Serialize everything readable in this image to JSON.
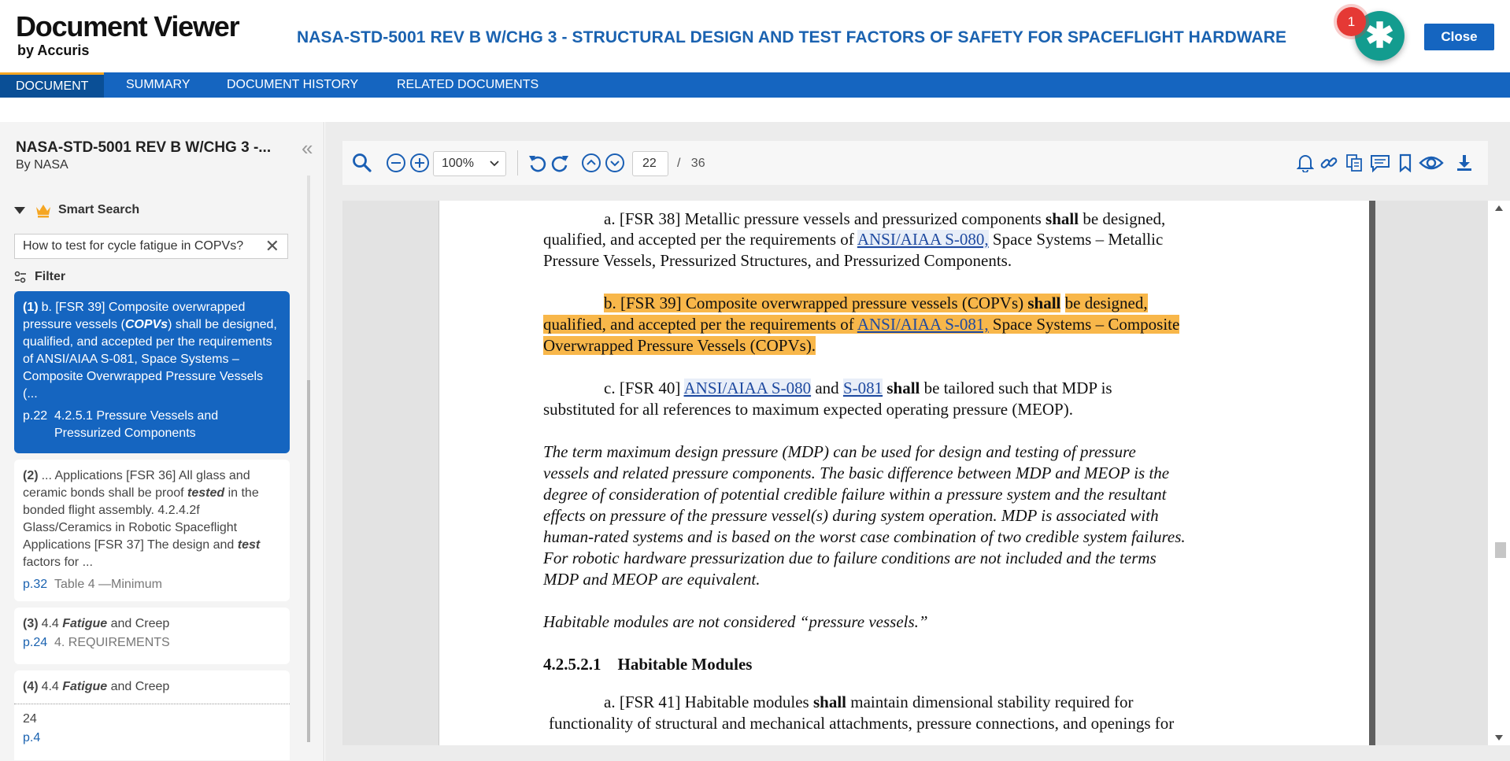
{
  "app": {
    "title": "Document Viewer",
    "subtitle": "by Accuris",
    "document_title": "NASA-STD-5001 REV B W/CHG 3 - STRUCTURAL DESIGN AND TEST FACTORS OF SAFETY FOR SPACEFLIGHT HARDWARE",
    "notification_count": "1",
    "assistant_icon": "✱",
    "close_label": "Close"
  },
  "colors": {
    "brand": "#1565c0",
    "accent": "#139c8f",
    "highlight": "#f8b74a",
    "badge": "#e53935"
  },
  "tabs": [
    {
      "label": "DOCUMENT",
      "active": true
    },
    {
      "label": "SUMMARY",
      "active": false
    },
    {
      "label": "DOCUMENT HISTORY",
      "active": false
    },
    {
      "label": "RELATED DOCUMENTS",
      "active": false
    }
  ],
  "sidebar": {
    "doc_name": "NASA-STD-5001 REV B W/CHG 3 -...",
    "by": "By NASA",
    "collapse_icon": "«",
    "smart_search_label": "Smart Search",
    "search_value": "How to test for cycle fatigue in COPVs?",
    "clear_icon": "✕",
    "filter_label": "Filter",
    "results": [
      {
        "num": "(1)",
        "text_a": "b. [FSR 39] Composite overwrapped pressure vessels (",
        "text_b": "COPVs",
        "text_c": ") shall be designed, qualified, and accepted per the requirements of ANSI/AIAA S-081, Space Systems – Composite Overwrapped Pressure Vessels (...",
        "page": "p.22",
        "section": "4.2.5.1 Pressure Vessels and Pressurized Components"
      },
      {
        "num": "(2)",
        "text_a": "... Applications [FSR 36] All glass and ceramic bonds shall be proof ",
        "text_b": "tested",
        "text_c": " in the bonded flight assembly. 4.2.4.2f Glass/Ceramics in Robotic Spaceflight Applications [FSR 37] The design and ",
        "text_d": "test",
        "text_e": " factors for ...",
        "page": "p.32",
        "section": "Table 4 —Minimum"
      },
      {
        "num": "(3)",
        "text_a": "4.4 ",
        "text_b": "Fatigue",
        "text_c": " and Creep",
        "page": "p.24",
        "section": "4. REQUIREMENTS"
      },
      {
        "num": "(4)",
        "text_a": "4.4 ",
        "text_b": "Fatigue",
        "text_c": " and Creep",
        "extra": "24",
        "page": "p.4"
      }
    ]
  },
  "toolbar": {
    "zoom": "100%",
    "current_page": "22",
    "page_sep": "/",
    "total_pages": "36"
  },
  "document": {
    "p_a_1": "a.   [FSR 38] Metallic pressure vessels and pressurized components ",
    "p_a_shall": "shall",
    "p_a_2": " be designed,",
    "p_a_3": "qualified, and accepted per the requirements of ",
    "p_a_link": "ANSI/AIAA S-080,",
    "p_a_4": " Space Systems – Metallic",
    "p_a_5": "Pressure Vessels, Pressurized Structures, and Pressurized Components.",
    "p_b_1": "b.   [FSR 39] Composite overwrapped pressure vessels (COPVs) ",
    "p_b_shall": "shall",
    "p_b_2": " be designed,",
    "p_b_3": "qualified, and accepted per the requirements of ",
    "p_b_link": "ANSI/AIAA S-081,",
    "p_b_4": " Space Systems – Composite",
    "p_b_5": "Overwrapped Pressure Vessels (COPVs).",
    "p_c_1": "c.   [FSR 40] ",
    "p_c_link1": "ANSI/AIAA S-080",
    "p_c_2": " and ",
    "p_c_link2": "S-081",
    "p_c_3": " ",
    "p_c_shall": "shall",
    "p_c_4": " be tailored such that MDP is",
    "p_c_5": "substituted for all references to maximum expected operating pressure (MEOP).",
    "note_1": "The term maximum design pressure (MDP) can be used for design and testing of pressure",
    "note_2": "vessels and related pressure components. The basic difference between MDP and MEOP is the",
    "note_3": "degree of consideration of potential credible failure within a pressure system and the resultant",
    "note_4": "effects on pressure of the pressure vessel(s) during system operation. MDP is associated with",
    "note_5": "human-rated systems and is based on the worst case combination of two credible system failures.",
    "note_6": "For robotic hardware pressurization due to failure conditions are not included and the terms",
    "note_7": "MDP and MEOP are equivalent.",
    "habitable_note": "Habitable modules are not considered “pressure vessels.”",
    "heading_num": "4.2.5.2.1",
    "heading_text": "Habitable Modules",
    "p_d_1": "a.   [FSR 41] Habitable modules ",
    "p_d_shall": "shall",
    "p_d_2": " maintain dimensional stability required for",
    "p_d_3": "functionality of structural and mechanical attachments, pressure connections, and openings for"
  }
}
